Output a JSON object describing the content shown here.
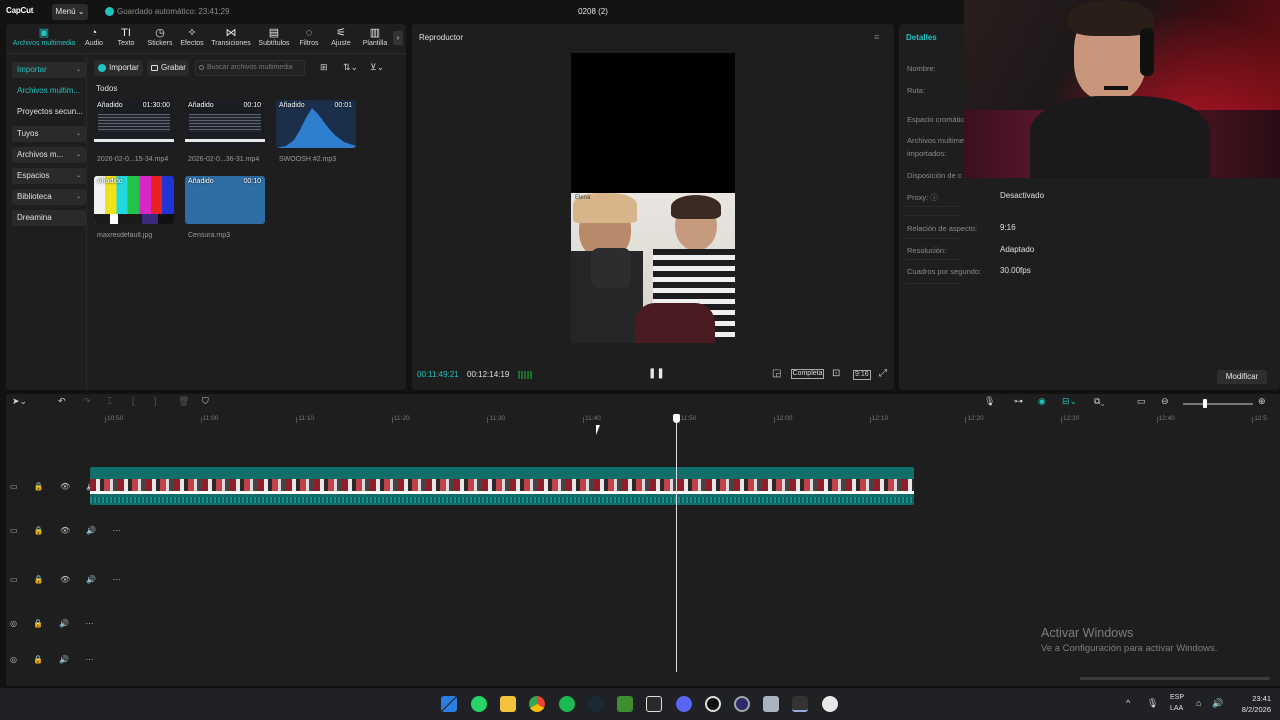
{
  "app": {
    "logo": "CapCut",
    "menu_label": "Menú ⌄",
    "autosave": "Guardado automático: 23:41:29",
    "project_title": "0208 (2)"
  },
  "toptabs": [
    {
      "label": "Archivos multimedia",
      "icon": "media-icon",
      "glyph": "▣",
      "active": true
    },
    {
      "label": "Audio",
      "icon": "audio-icon",
      "glyph": "◔"
    },
    {
      "label": "Texto",
      "icon": "text-icon",
      "glyph": "TI"
    },
    {
      "label": "Stickers",
      "icon": "sticker-icon",
      "glyph": "◷"
    },
    {
      "label": "Efectos",
      "icon": "effects-icon",
      "glyph": "✧"
    },
    {
      "label": "Transiciones",
      "icon": "transition-icon",
      "glyph": "⋈"
    },
    {
      "label": "Subtítulos",
      "icon": "subtitle-icon",
      "glyph": "▤"
    },
    {
      "label": "Filtros",
      "icon": "filter-icon",
      "glyph": "◌"
    },
    {
      "label": "Ajuste",
      "icon": "adjust-icon",
      "glyph": "⚟"
    },
    {
      "label": "Plantilla",
      "icon": "template-icon",
      "glyph": "▥"
    }
  ],
  "sidenav": [
    {
      "label": "Importar",
      "teal": true,
      "box": true,
      "dropdown": "⌄"
    },
    {
      "label": "Archivos multim...",
      "teal": true,
      "box": false
    },
    {
      "label": "Proyectos secun...",
      "box": false
    },
    {
      "label": "Tuyos",
      "box": true,
      "dropdown": "⌄"
    },
    {
      "label": "Archivos m...",
      "box": true,
      "dropdown": "⌄"
    },
    {
      "label": "Espacios",
      "box": true,
      "dropdown": "⌄"
    },
    {
      "label": "Biblioteca",
      "box": true,
      "dropdown": "⌄"
    },
    {
      "label": "Dreamina",
      "box": true
    }
  ],
  "media_toolbar": {
    "import": "Importar",
    "record": "Grabar",
    "search_placeholder": "Buscar archivos multimedia",
    "filter_all": "Todos"
  },
  "media": [
    {
      "name": "2026-02-0...15-34.mp4",
      "badge": "Añadido",
      "duration": "01:30:00",
      "kind": "screen"
    },
    {
      "name": "2026-02-0...36-31.mp4",
      "badge": "Añadido",
      "duration": "00:10",
      "kind": "screen"
    },
    {
      "name": "SWOOSH #2.mp3",
      "badge": "Añadido",
      "duration": "00:01",
      "kind": "wave"
    },
    {
      "name": "maxresdefault.jpg",
      "badge": "Añadido",
      "duration": "",
      "kind": "bars"
    },
    {
      "name": "Censura.mp3",
      "badge": "Añadido",
      "duration": "00:10",
      "kind": "blue"
    }
  ],
  "player": {
    "title": "Reproductor",
    "current": "00:11:49:21",
    "total": "00:12:14:19",
    "full_label": "Completa",
    "ratio": "9:16",
    "overlay_text": "Elena"
  },
  "details": {
    "title": "Detalles",
    "rows": [
      {
        "label": "Nombre:",
        "value": ""
      },
      {
        "label": "Ruta:",
        "value": ""
      },
      {
        "label": "Espacio cromático",
        "value": ""
      },
      {
        "label": "Archivos multime",
        "value": ""
      },
      {
        "label": "importados:",
        "value": ""
      },
      {
        "label": "Disposición de c",
        "value": ""
      },
      {
        "label": "Proxy: ⓘ",
        "value": "Desactivado"
      },
      {
        "label": "Relación de aspecto:",
        "value": "9:16"
      },
      {
        "label": "Resolución:",
        "value": "Adaptado"
      },
      {
        "label": "Cuadros por segundo:",
        "value": "30.00fps"
      }
    ],
    "modify": "Modificar"
  },
  "ruler": [
    "10:50",
    "11:00",
    "11:10",
    "11:20",
    "11:30",
    "11:40",
    "11:50",
    "12:00",
    "12:10",
    "12:20",
    "12:30",
    "12:40",
    "12:5"
  ],
  "track_heads": [
    "▭ 🔒 👁 🔊 ⋯",
    "▭ 🔒 👁 🔊 ⋯",
    "▭ 🔒 👁 🔊 ⋯",
    "◎ 🔒   🔊 ⋯",
    "◎ 🔒   🔊 ⋯"
  ],
  "windows_watermark": {
    "line1": "Activar Windows",
    "line2": "Ve a Configuración para activar Windows."
  },
  "taskbar": {
    "lang1": "ESP",
    "lang2": "LAA",
    "time": "23:41",
    "date": "8/2/2026"
  },
  "colors": {
    "accent": "#20c3c0",
    "panel": "#1e1e1e",
    "bg": "#121212"
  }
}
